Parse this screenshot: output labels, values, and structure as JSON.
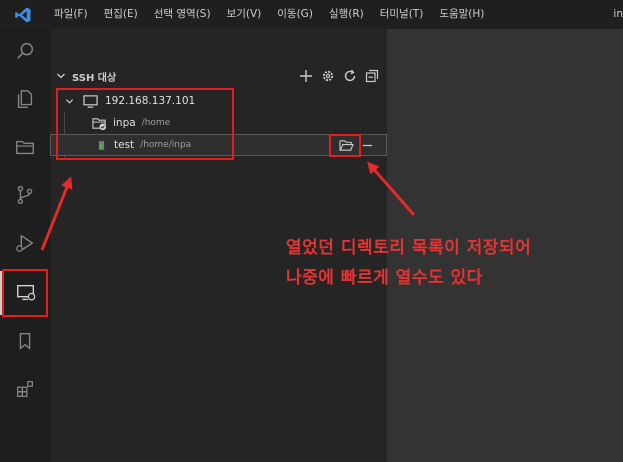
{
  "menu": {
    "items": [
      "파일(F)",
      "편집(E)",
      "선택 영역(S)",
      "보기(V)",
      "이동(G)",
      "실행(R)",
      "터미널(T)",
      "도움말(H)"
    ],
    "title_fragment": "in"
  },
  "sidebar": {
    "section_title": "SSH 대상",
    "tree": {
      "host": {
        "label": "192.168.137.101"
      },
      "folders": [
        {
          "label": "inpa",
          "path": "/home"
        },
        {
          "label": "test",
          "path": "/home/inpa"
        }
      ]
    }
  },
  "annotation": {
    "line1": "열었던 디렉토리 목록이 저장되어",
    "line2": "나중에 빠르게 열수도 있다"
  },
  "colors": {
    "annotation": "#e53232",
    "highlight_box": "#e51c1c",
    "vscode_blue": "#3c8ee6"
  }
}
